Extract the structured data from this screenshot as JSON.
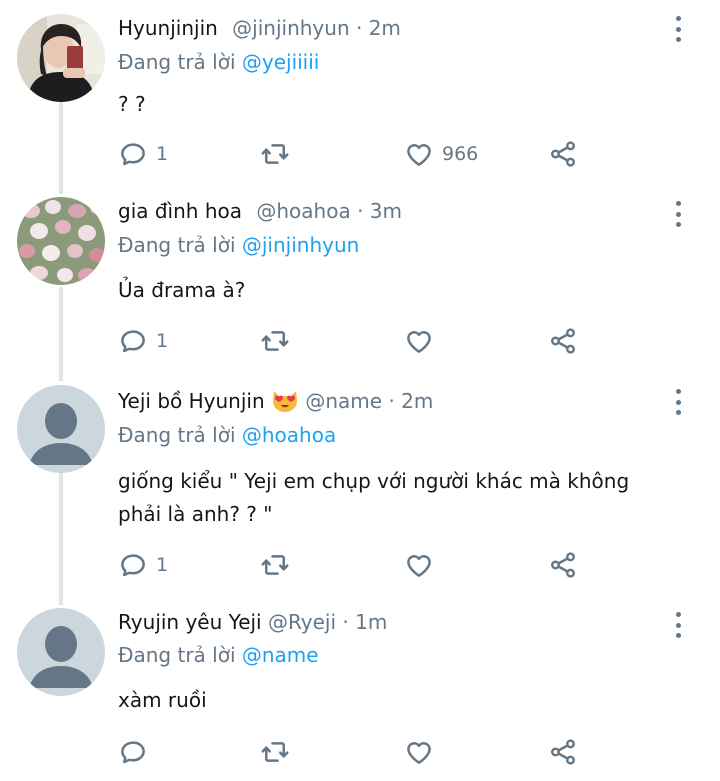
{
  "replies": [
    {
      "name": "Hyunjinjin",
      "handle": "@jinjinhyun",
      "time": "2m",
      "reply_prefix": "Đang trả lời",
      "reply_to": "@yejiiiii",
      "text": "? ?",
      "reply_count": "1",
      "retweet_count": "",
      "like_count": "966",
      "avatar": "photo-selfie"
    },
    {
      "name": "gia đình hoa",
      "handle": "@hoahoa",
      "time": "3m",
      "reply_prefix": "Đang trả lời",
      "reply_to": "@jinjinhyun",
      "text": "Ủa đrama à?",
      "reply_count": "1",
      "retweet_count": "",
      "like_count": "",
      "avatar": "photo-tulips"
    },
    {
      "name": "Yeji bồ Hyunjin",
      "emoji": "heart-eyes-cat-emoji",
      "handle": "@name",
      "time": "2m",
      "reply_prefix": "Đang trả lời",
      "reply_to": "@hoahoa",
      "text_line1": "giống kiểu \" Yeji em chụp với người khác mà không",
      "text_line2": "phải là anh? ? \"",
      "reply_count": "1",
      "retweet_count": "",
      "like_count": "",
      "avatar": "default-avatar"
    },
    {
      "name": "Ryujin yêu Yeji",
      "handle": "@Ryeji",
      "time": "1m",
      "reply_prefix": "Đang trả lời",
      "reply_to": "@name",
      "text": "xàm ruồi",
      "reply_count": "",
      "retweet_count": "",
      "like_count": "",
      "avatar": "default-avatar"
    }
  ],
  "separator": "·",
  "colors": {
    "text": "#14171a",
    "secondary": "#657786",
    "link": "#1da1f2",
    "thread_line": "#e1e4e8",
    "default_avatar_bg": "#ccd6dd",
    "default_avatar_fg": "#657786"
  },
  "icons": [
    "reply-icon",
    "retweet-icon",
    "like-icon",
    "share-icon",
    "more-options-icon"
  ]
}
